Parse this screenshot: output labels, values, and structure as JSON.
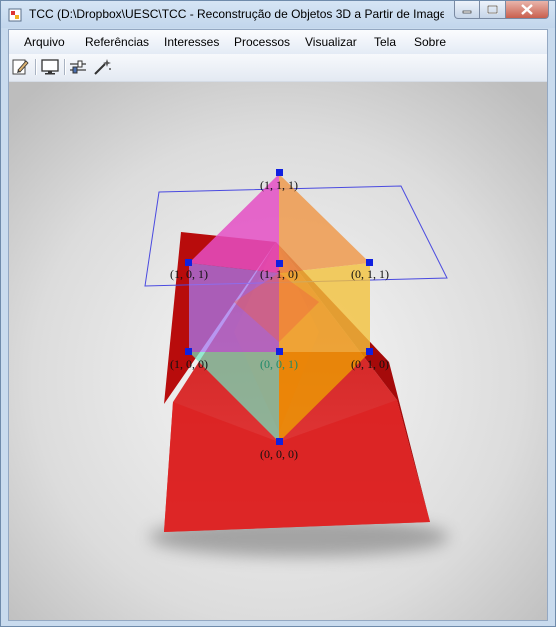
{
  "window": {
    "title": "TCC (D:\\Dropbox\\UESC\\TCC - Reconstrução de Objetos 3D a Partir de Image..."
  },
  "menu": {
    "items": [
      "Arquivo",
      "Referências",
      "Interesses",
      "Processos",
      "Visualizar",
      "Tela",
      "Sobre"
    ]
  },
  "toolbar": {
    "icons": [
      "edit-document-icon",
      "monitor-icon",
      "sliders-icon",
      "magic-wand-icon"
    ]
  },
  "scene": {
    "vertex_labels": [
      "(1, 1, 1)",
      "(1, 0, 1)",
      "(1, 1, 0)",
      "(0, 1, 1)",
      "(1, 0, 0)",
      "(0, 0, 1)",
      "(0, 1, 0)",
      "(0, 0, 0)"
    ],
    "colors": {
      "pyramid": "#d81818",
      "magenta_face": "#e44fc4",
      "orange_face": "#ee9a4e",
      "purple_face": "#a678f0",
      "yellow_face": "#f2c23c",
      "cyan_face": "#6ee8c2",
      "vertex": "#1020e0",
      "plane": "#4a4ae0"
    }
  }
}
